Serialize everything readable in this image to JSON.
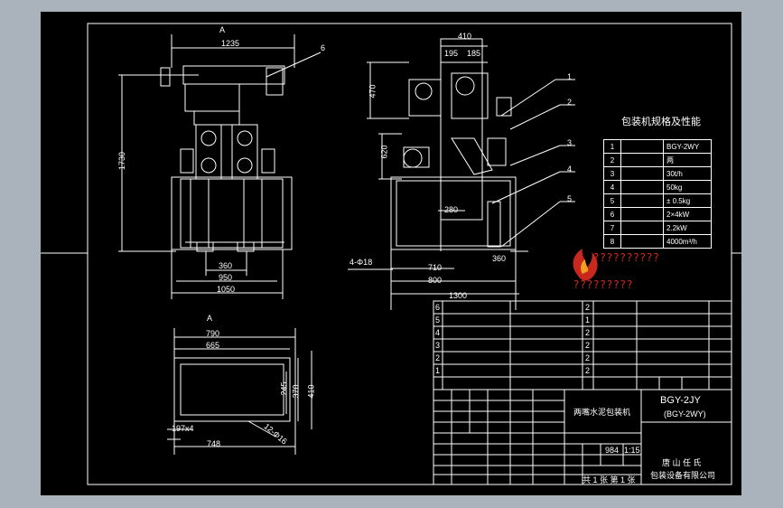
{
  "colors": {
    "background": "#000000",
    "lines": "#ffffff",
    "outer": "#aab3bc",
    "logo": "#c8281e"
  },
  "dims": {
    "front_top": "1235",
    "front_height": "1730",
    "front_w1": "360",
    "front_w2": "950",
    "front_w3": "1050",
    "side_top": "410",
    "side_sub1": "195",
    "side_sub2": "185",
    "side_h1": "470",
    "side_h2": "620",
    "side_mid": "280",
    "side_w1": "710",
    "side_w2": "800",
    "side_w3": "1300",
    "side_bolt": "4-Φ18",
    "side_r": "360",
    "plan_w1": "790",
    "plan_w2": "665",
    "plan_w3": "748",
    "plan_h1": "245",
    "plan_h2": "370",
    "plan_h3": "410",
    "plan_d1": "197x4",
    "plan_d2": "12-Φ16",
    "view_a1": "A",
    "view_a2": "A"
  },
  "callouts": [
    "1",
    "2",
    "3",
    "4",
    "5",
    "6"
  ],
  "spec_title": "包装机规格及性能",
  "spec_rows": [
    {
      "n": "1",
      "v": "BGY-2WY"
    },
    {
      "n": "2",
      "v": "两"
    },
    {
      "n": "3",
      "v": "30t/h"
    },
    {
      "n": "4",
      "v": "50kg"
    },
    {
      "n": "5",
      "v": "± 0.5kg"
    },
    {
      "n": "6",
      "v": "2×4kW"
    },
    {
      "n": "7",
      "v": "2.2kW"
    },
    {
      "n": "8",
      "v": "4000m³/h"
    }
  ],
  "logo_line1": "??????????",
  "logo_line2": "?????????",
  "title_block": {
    "product_name": "两嘴水泥包装机",
    "model": "BGY-2JY",
    "model_sub": "(BGY-2WY)",
    "company_line1": "唐 山 任 氏",
    "company_line2": "包装设备有限公司",
    "weight": "984",
    "scale": "1:15",
    "sheet": "共 1 张  第 1 张"
  },
  "bom_rows": [
    {
      "n": "6",
      "q": "2"
    },
    {
      "n": "5",
      "q": "1"
    },
    {
      "n": "4",
      "q": "2"
    },
    {
      "n": "3",
      "q": "2"
    },
    {
      "n": "2",
      "q": "2"
    },
    {
      "n": "1",
      "q": "2"
    }
  ]
}
